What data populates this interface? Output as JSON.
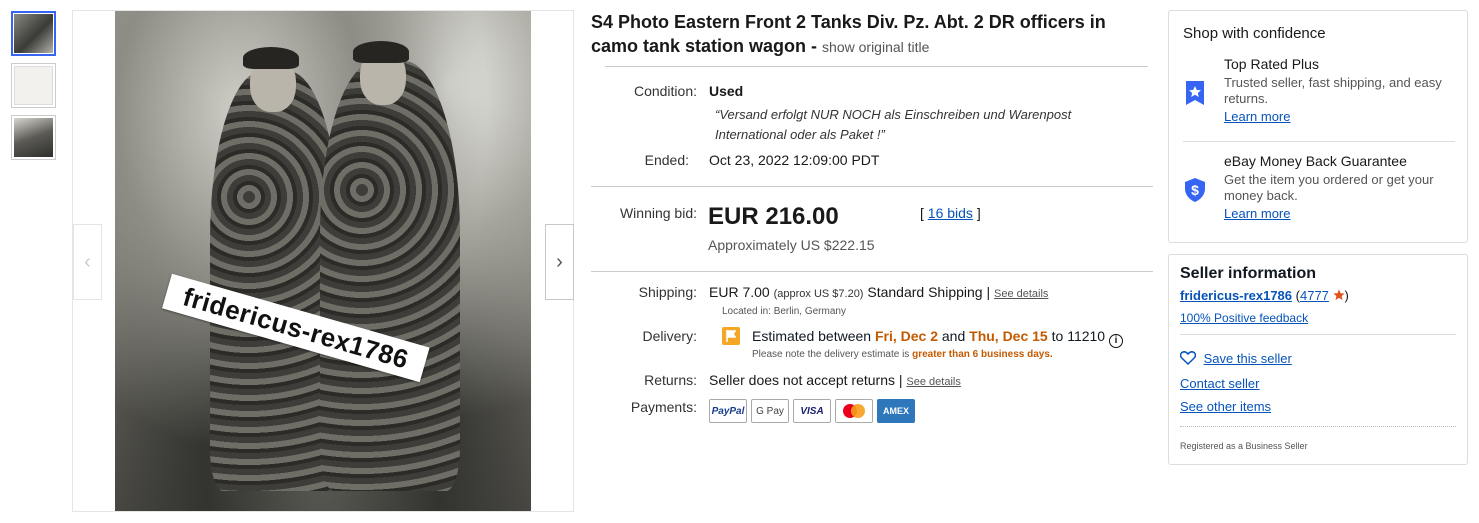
{
  "gallery": {
    "watermark_text": "fridericus-rex1786",
    "prev_glyph": "‹",
    "next_glyph": "›"
  },
  "listing": {
    "title": "S4 Photo Eastern Front 2 Tanks Div. Pz. Abt. 2 DR officers in camo tank station wagon -",
    "show_original": "show original title",
    "condition_label": "Condition:",
    "condition_value": "Used",
    "condition_note": "“Versand erfolgt NUR NOCH als Einschreiben und Warenpost International oder als Paket !”",
    "ended_label": "Ended:",
    "ended_value": "Oct 23, 2022 12:09:00 PDT",
    "winning_bid_label": "Winning bid:",
    "winning_bid_value": "EUR 216.00",
    "bids_open": "[",
    "bids_link": "16 bids",
    "bids_close": "]",
    "approx_value": "Approximately US $222.15",
    "shipping_label": "Shipping:",
    "shipping_value": "EUR 7.00",
    "shipping_approx": "(approx US $7.20)",
    "shipping_type": "Standard Shipping",
    "shipping_sep": "|",
    "shipping_details": "See details",
    "located_in": "Located in: Berlin, Germany",
    "delivery_label": "Delivery:",
    "delivery_prefix": "Estimated between",
    "delivery_start": "Fri, Dec 2",
    "delivery_and": "and",
    "delivery_end": "Thu, Dec 15",
    "delivery_to": "to 11210",
    "delivery_note_prefix": "Please note the delivery estimate is",
    "delivery_note_emph": "greater than 6 business days.",
    "returns_label": "Returns:",
    "returns_value": "Seller does not accept returns",
    "returns_sep": "|",
    "returns_details": "See details",
    "payments_label": "Payments:",
    "payments": [
      "PayPal",
      "G Pay",
      "VISA",
      "",
      "AMEX"
    ]
  },
  "confidence": {
    "heading": "Shop with confidence",
    "items": [
      {
        "title": "Top Rated Plus",
        "desc": "Trusted seller, fast shipping, and easy returns.",
        "link": "Learn more",
        "icon": "badge-icon"
      },
      {
        "title": "eBay Money Back Guarantee",
        "desc": "Get the item you ordered or get your money back.",
        "link": "Learn more",
        "icon": "shield-dollar-icon"
      }
    ]
  },
  "seller": {
    "heading": "Seller information",
    "name": "fridericus-rex1786",
    "paren_open": "(",
    "score": "4777",
    "paren_close": ")",
    "feedback": "100% Positive feedback",
    "save": "Save this seller",
    "contact": "Contact seller",
    "other": "See other items",
    "registered": "Registered as a Business Seller"
  },
  "colors": {
    "link": "#0654ba",
    "accent_orange": "#c45a00",
    "star": "#e0521b",
    "badge_blue": "#3665f3"
  }
}
